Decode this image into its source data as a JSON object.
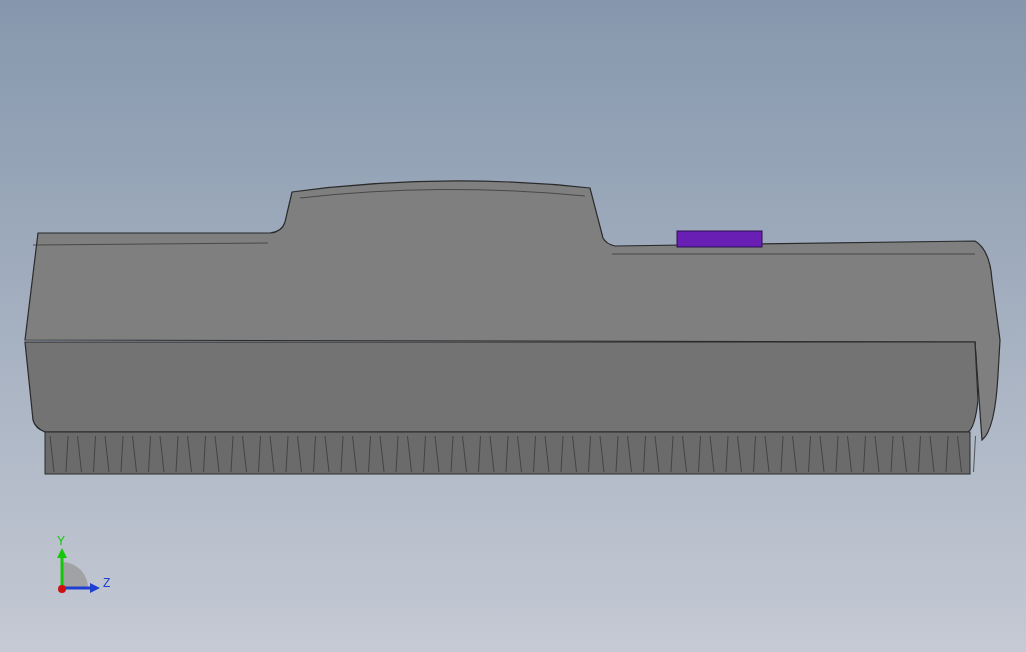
{
  "viewport": {
    "triad": {
      "axes": [
        {
          "label": "Y",
          "color": "#16c60c"
        },
        {
          "label": "Z",
          "color": "#1f3fd0"
        }
      ]
    }
  }
}
